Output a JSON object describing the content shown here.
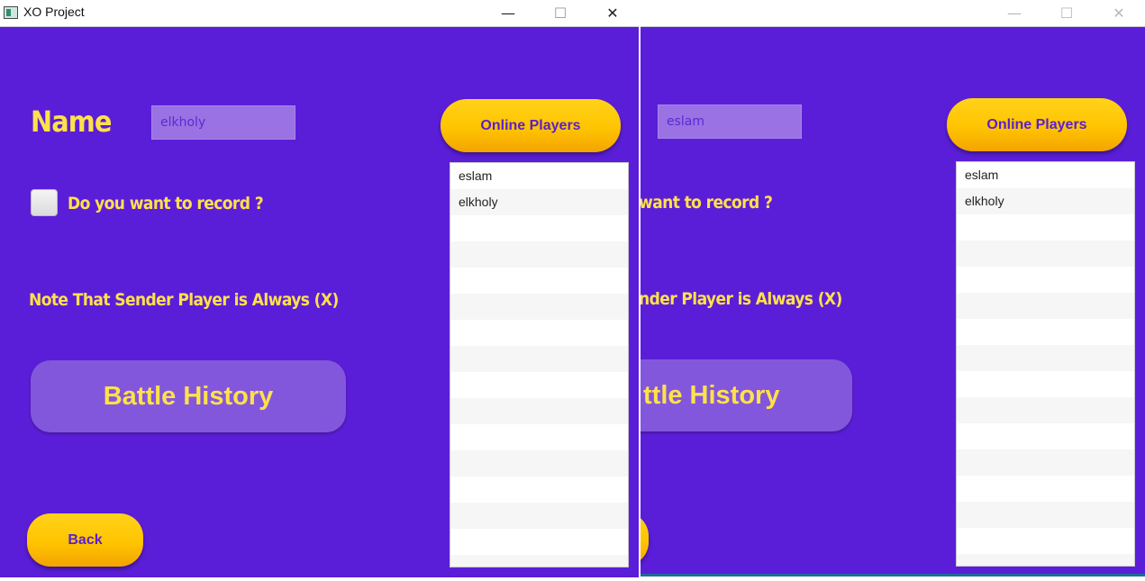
{
  "windows": {
    "left": {
      "title": "XO Project",
      "name_label": "Name",
      "name_value": "elkholy",
      "online_players_label": "Online Players",
      "record_label": "Do you want to record ?",
      "note_text": "Note That Sender Player is Always (X)",
      "battle_history_label": "Battle History",
      "back_label": "Back",
      "players": [
        "eslam",
        "elkholy",
        "",
        "",
        "",
        "",
        "",
        "",
        "",
        "",
        "",
        "",
        "",
        "",
        "",
        ""
      ]
    },
    "right": {
      "name_value": "eslam",
      "online_players_label": "Online Players",
      "record_label_partial": "want to record ?",
      "note_text_partial": "nder Player is Always (X)",
      "battle_history_partial": "ttle History",
      "players": [
        "eslam",
        "elkholy",
        "",
        "",
        "",
        "",
        "",
        "",
        "",
        "",
        "",
        "",
        "",
        "",
        "",
        ""
      ]
    }
  },
  "window_controls": {
    "minimize": "—",
    "maximize": "☐",
    "close": "✕"
  },
  "colors": {
    "background": "#5b1ed8",
    "accent_yellow": "#ffe14a",
    "button_gold": "#ffc400"
  }
}
